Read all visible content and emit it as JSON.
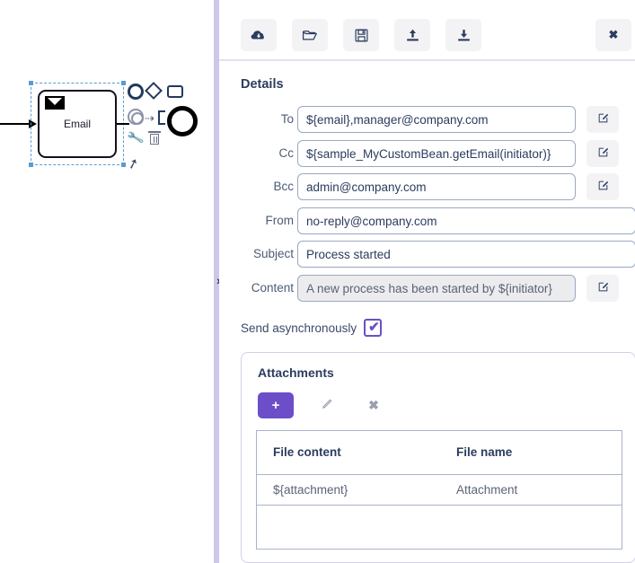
{
  "canvas": {
    "task": {
      "label": "Email",
      "icon": "envelope-icon",
      "selected": true
    },
    "context_pad": [
      {
        "name": "end-event-icon",
        "glyph": "circle"
      },
      {
        "name": "gateway-icon",
        "glyph": "diamond"
      },
      {
        "name": "task-icon",
        "glyph": "rectangle"
      },
      {
        "name": "intermediate-event-icon",
        "glyph": "double-circle"
      },
      {
        "name": "association-icon",
        "glyph": "⇢"
      },
      {
        "name": "data-object-icon",
        "glyph": "bracket"
      },
      {
        "name": "hover-circle-icon",
        "glyph": "thick-circle"
      },
      {
        "name": "wrench-icon",
        "glyph": "\u0001F527"
      },
      {
        "name": "trash-icon",
        "glyph": "trash"
      },
      {
        "name": "connect-icon",
        "glyph": "➚"
      }
    ]
  },
  "divider": {
    "handle_glyph": "›"
  },
  "toolbar": {
    "buttons": [
      {
        "name": "deploy-button",
        "icon": "cloud-upload-icon"
      },
      {
        "name": "open-button",
        "icon": "open-folder-icon"
      },
      {
        "name": "save-button",
        "icon": "floppy-save-icon"
      },
      {
        "name": "upload-button",
        "icon": "upload-icon"
      },
      {
        "name": "download-button",
        "icon": "download-icon"
      }
    ],
    "close": {
      "name": "close-button",
      "icon": "close-x-icon",
      "glyph": "✖"
    }
  },
  "details": {
    "title": "Details",
    "fields": [
      {
        "key": "to",
        "label": "To",
        "value": "${email},manager@company.com",
        "readonly": false,
        "has_edit": true
      },
      {
        "key": "cc",
        "label": "Cc",
        "value": "${sample_MyCustomBean.getEmail(initiator)}",
        "readonly": false,
        "has_edit": true
      },
      {
        "key": "bcc",
        "label": "Bcc",
        "value": "admin@company.com",
        "readonly": false,
        "has_edit": true
      },
      {
        "key": "from",
        "label": "From",
        "value": "no-reply@company.com",
        "readonly": false,
        "has_edit": false
      },
      {
        "key": "subject",
        "label": "Subject",
        "value": "Process started",
        "readonly": false,
        "has_edit": false
      },
      {
        "key": "content",
        "label": "Content",
        "value": "A new process has been started by ${initiator}",
        "readonly": true,
        "has_edit": true
      }
    ],
    "edit_glyph": "✎",
    "async": {
      "label": "Send asynchronously",
      "checked": true,
      "tick_glyph": "✔"
    }
  },
  "attachments": {
    "title": "Attachments",
    "add_label": "+",
    "edit_glyph": "✎",
    "delete_glyph": "✖",
    "columns": [
      "File content",
      "File name"
    ],
    "rows": [
      {
        "file_content": "${attachment}",
        "file_name": "Attachment"
      }
    ]
  },
  "colors": {
    "accent_purple": "#6b4ec8",
    "divider_purple": "#cdc8ea",
    "text_dark": "#2b3c5e",
    "label_gray": "#4d5b75",
    "input_border": "#9aa8c4",
    "readonly_bg": "#ececee",
    "button_bg": "#f3f3f5",
    "table_border": "#aab4c8"
  }
}
